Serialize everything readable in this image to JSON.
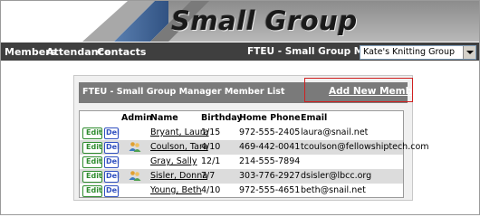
{
  "app": {
    "title": "Small Group",
    "colors": {
      "nav": "#3f3f3f",
      "banner_dark": "#1f3f6f",
      "highlight": "#d02020",
      "edit": "#2e8b2e",
      "del": "#3050c0"
    }
  },
  "nav": {
    "members": "Members",
    "attendance": "Attendance",
    "contacts": "Contacts",
    "manager_label": "FTEU - Small Group Manager:",
    "group_select_value": "Kate's Knitting Group"
  },
  "panel": {
    "title": "FTEU - Small Group Manager Member List",
    "add_link": "Add New Member"
  },
  "table": {
    "headers": {
      "admin": "Admin",
      "name": "Name",
      "birthday": "Birthday",
      "home_phone": "Home Phone",
      "email": "Email"
    },
    "edit_label": "Edit",
    "del_label": "Del",
    "rows": [
      {
        "name": "Bryant, Laura",
        "birthday": "1/15",
        "phone": "972-555-2405",
        "email": "laura@snail.net",
        "admin": false
      },
      {
        "name": "Coulson, Tara",
        "birthday": "4/10",
        "phone": "469-442-0041",
        "email": "tcoulson@fellowshiptech.com",
        "admin": true
      },
      {
        "name": "Gray, Sally",
        "birthday": "12/1",
        "phone": "214-555-7894",
        "email": "",
        "admin": false
      },
      {
        "name": "Sisler, Donna",
        "birthday": "7/7",
        "phone": "303-776-2927",
        "email": "dsisler@lbcc.org",
        "admin": true
      },
      {
        "name": "Young, Beth",
        "birthday": "4/10",
        "phone": "972-555-4651",
        "email": "beth@snail.net",
        "admin": false
      }
    ]
  }
}
